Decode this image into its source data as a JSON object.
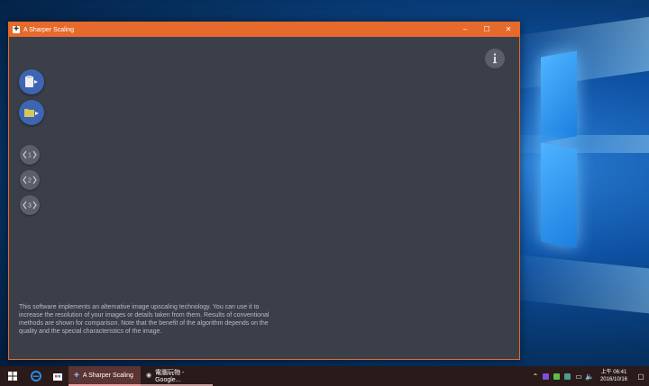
{
  "window": {
    "title": "A Sharper Scaling",
    "minimize": "–",
    "maximize": "☐",
    "close": "✕"
  },
  "toolbar": {
    "compare_1": "1",
    "compare_2": "2",
    "compare_3": "3"
  },
  "description": "This software implements an alternative image upscaling technology. You can use it to increase the resolution of your images or details taken from them. Results of conventional methods are shown for comparison. Note that the benefit of the algorithm depends on the quality and the special characteristics of the image.",
  "taskbar": {
    "task_1": "A Sharper Scaling",
    "task_2": "電腦玩物 - Google...",
    "time": "上午 06:41",
    "date": "2016/10/16"
  },
  "colors": {
    "titlebar": "#e66a2b",
    "window_bg": "#3b3f4a",
    "fab_blue": "#3d65b3",
    "fab_gray": "#5a5f6b"
  }
}
